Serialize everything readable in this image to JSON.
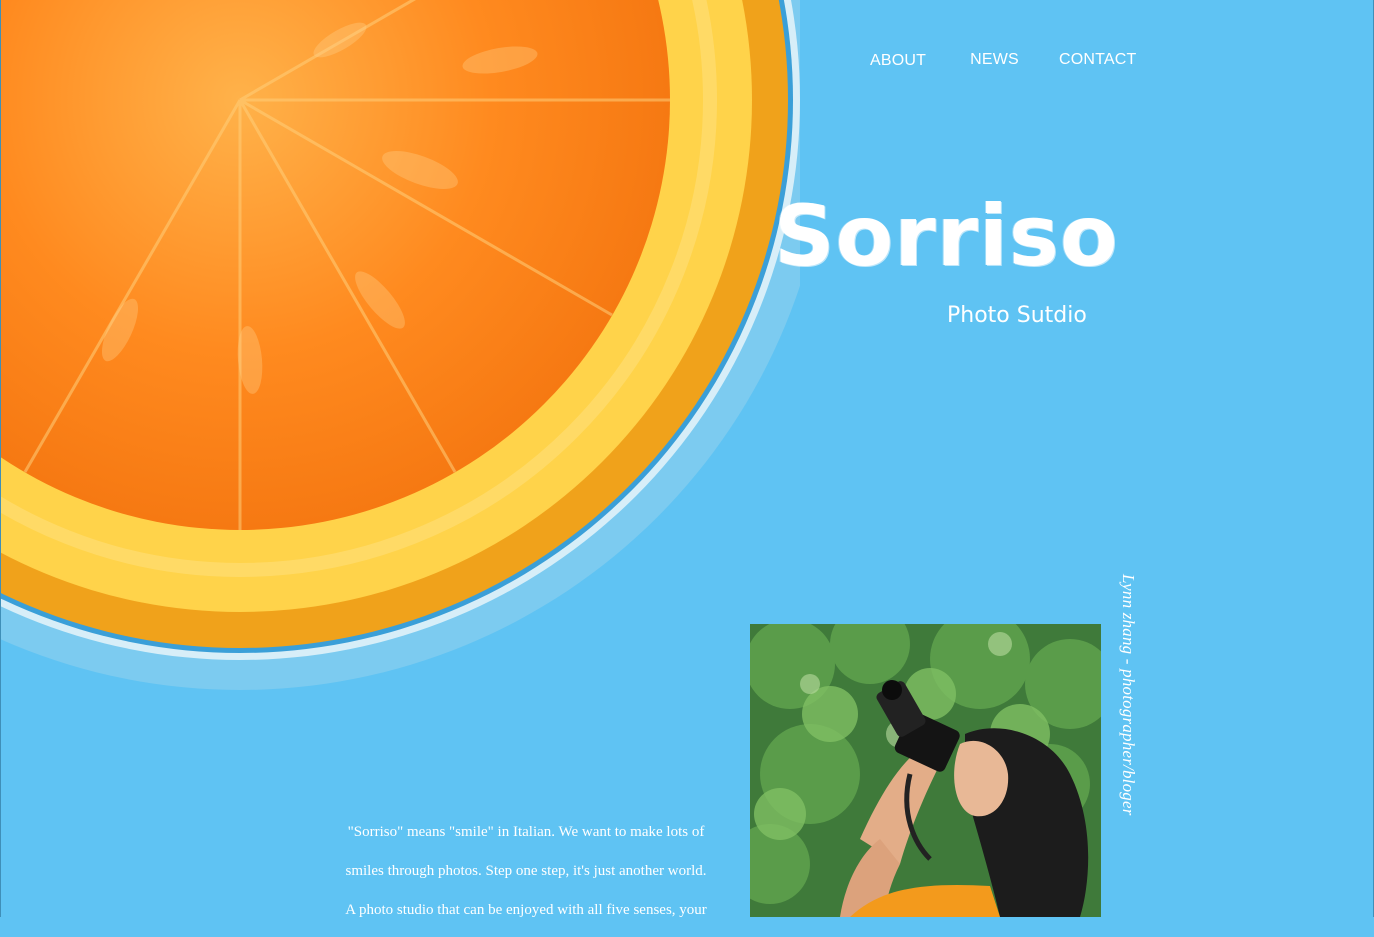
{
  "nav": {
    "items": [
      {
        "label": "ABOUT"
      },
      {
        "label": "NEWS"
      },
      {
        "label": "CONTACT"
      }
    ]
  },
  "brand": {
    "title": "Sorriso",
    "subtitle": "Photo Sutdio"
  },
  "credit": "Lynn zhang - photographer/bloger",
  "about": {
    "lines": [
      "\"Sorriso\" means \"smile\" in Italian. We want to make lots of",
      "smiles through photos. Step one step, it's just another world.",
      "A photo studio that can be enjoyed with all five senses, your"
    ]
  },
  "colors": {
    "background": "#5fc3f3",
    "text": "#ffffff",
    "orange": "#f7941d",
    "rind": "#f6b92c"
  },
  "images": {
    "hero": "orange-slice",
    "portrait": "photographer-with-camera"
  }
}
